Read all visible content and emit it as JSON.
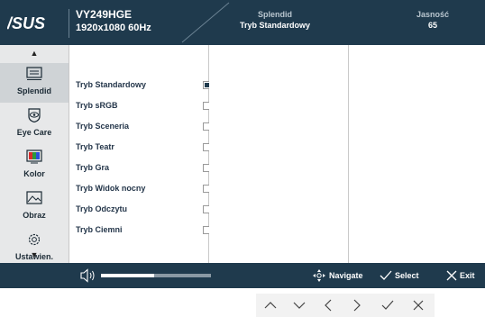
{
  "header": {
    "brand": "ASUS",
    "model": "VY249HGE",
    "resolution": "1920x1080 60Hz",
    "mode_label": "Splendid",
    "mode_value": "Tryb Standardowy",
    "brightness_label": "Jasność",
    "brightness_value": "65"
  },
  "sidebar": {
    "items": [
      {
        "label": "Splendid",
        "icon": "splendid-icon"
      },
      {
        "label": "Eye Care",
        "icon": "eye-icon"
      },
      {
        "label": "Kolor",
        "icon": "color-icon"
      },
      {
        "label": "Obraz",
        "icon": "image-icon"
      },
      {
        "label": "Ustawien.",
        "icon": "settings-icon"
      }
    ]
  },
  "options": [
    {
      "label": "Tryb Standardowy",
      "selected": true
    },
    {
      "label": "Tryb sRGB",
      "selected": false
    },
    {
      "label": "Tryb Sceneria",
      "selected": false
    },
    {
      "label": "Tryb Teatr",
      "selected": false
    },
    {
      "label": "Tryb Gra",
      "selected": false
    },
    {
      "label": "Tryb Widok nocny",
      "selected": false
    },
    {
      "label": "Tryb Odczytu",
      "selected": false
    },
    {
      "label": "Tryb Ciemni",
      "selected": false
    }
  ],
  "footer": {
    "volume_level": 0.48,
    "navigate_label": "Navigate",
    "select_label": "Select",
    "exit_label": "Exit"
  },
  "colors": {
    "header_bg": "#1f3a4d",
    "sidebar_bg": "#e7e8e9"
  }
}
